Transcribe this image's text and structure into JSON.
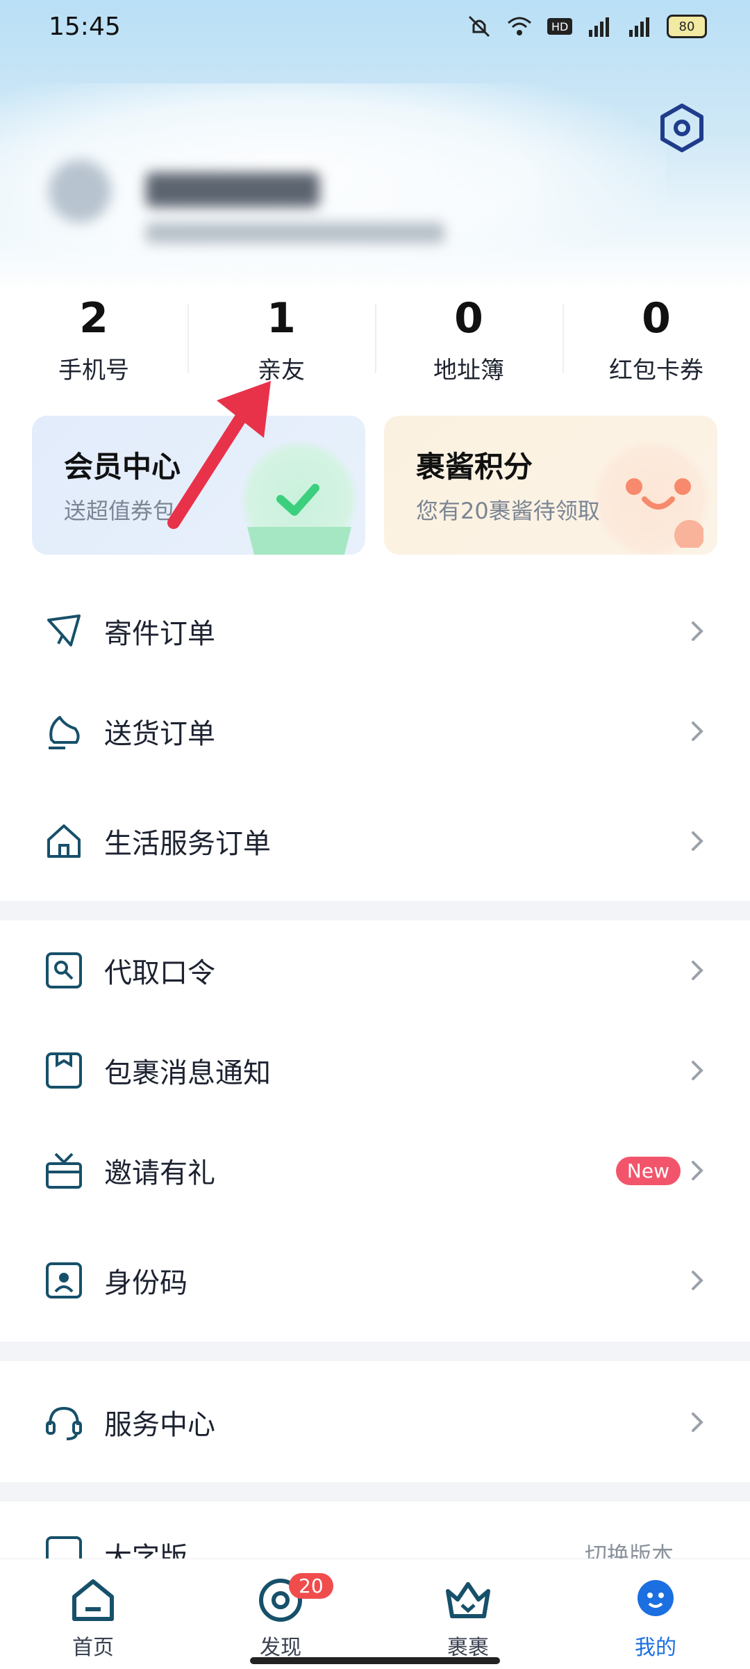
{
  "status_bar": {
    "time": "15:45",
    "battery": "80"
  },
  "stats": [
    {
      "value": "2",
      "label": "手机号"
    },
    {
      "value": "1",
      "label": "亲友"
    },
    {
      "value": "0",
      "label": "地址簿"
    },
    {
      "value": "0",
      "label": "红包卡券"
    }
  ],
  "cards": {
    "member": {
      "title": "会员中心",
      "desc": "送超值券包"
    },
    "points": {
      "title": "裹酱积分",
      "desc": "您有20裹酱待领取"
    }
  },
  "menu": {
    "ship_orders": "寄件订单",
    "delivery_orders": "送货订单",
    "life_orders": "生活服务订单",
    "pickup_code": "代取口令",
    "parcel_notify": "包裹消息通知",
    "invite": "邀请有礼",
    "invite_badge": "New",
    "id_code": "身份码",
    "service_center": "服务中心",
    "version": "大字版",
    "version_right": "切换版本"
  },
  "tabs": {
    "home": "首页",
    "discover": "发现",
    "discover_badge": "20",
    "parcels": "裹裹",
    "mine": "我的"
  },
  "colors": {
    "accent": "#1b6fe0",
    "icon": "#17506a",
    "badge": "#f04c4c",
    "arrow": "#e8324a"
  }
}
